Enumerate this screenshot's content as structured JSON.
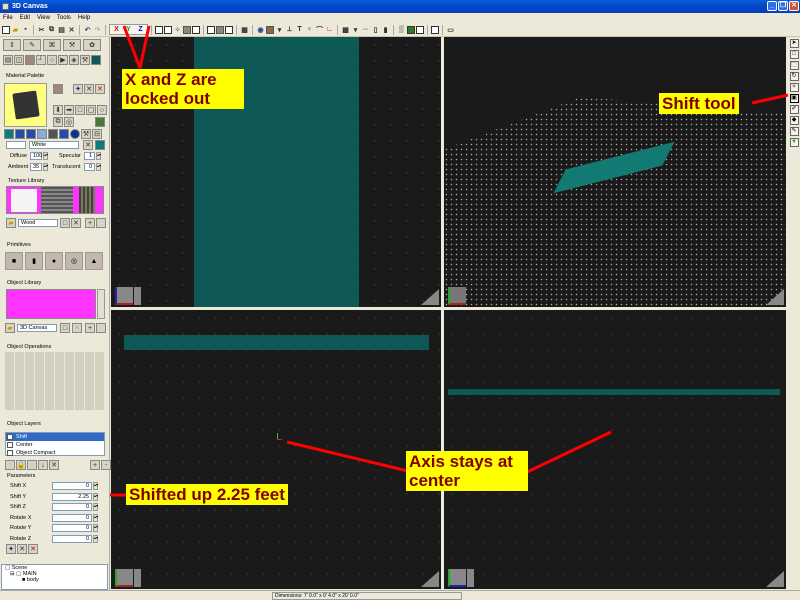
{
  "window": {
    "title": "3D Canvas",
    "controls": [
      "minimize",
      "restore",
      "close"
    ]
  },
  "menu": [
    "File",
    "Edit",
    "View",
    "Tools",
    "Help"
  ],
  "toolbar": {
    "axis_lock": {
      "x": "X",
      "y": "Y",
      "z": "Z"
    },
    "buttons": [
      "new-icon",
      "open-icon",
      "save-icon",
      "cut-icon",
      "copy-icon",
      "paste-icon",
      "delete-icon",
      "undo-icon",
      "redo-icon"
    ]
  },
  "left_panel": {
    "material_palette": {
      "title": "Material Palette",
      "material_name": "White",
      "diffuse_label": "Diffuse",
      "diffuse_value": "100",
      "specular_label": "Specular",
      "specular_value": "1",
      "ambient_label": "Ambient",
      "ambient_value": "35",
      "translucent_label": "Translucent",
      "translucent_value": "0"
    },
    "texture_library": {
      "title": "Texture Library",
      "selected": "Wood"
    },
    "primitives": {
      "title": "Primitives",
      "items": [
        "cube",
        "cylinder",
        "sphere",
        "torus",
        "cone"
      ]
    },
    "object_library": {
      "title": "Object Library",
      "selected": "3D Canvas"
    },
    "object_operations": {
      "title": "Object Operations"
    },
    "object_layers": {
      "title": "Object Layers",
      "items": [
        {
          "name": "Shift",
          "selected": true
        },
        {
          "name": "Center",
          "selected": false
        },
        {
          "name": "Object Compact",
          "selected": false
        }
      ]
    },
    "parameters": {
      "title": "Parameters",
      "items": [
        {
          "label": "Shift X",
          "value": "0"
        },
        {
          "label": "Shift Y",
          "value": "2.25"
        },
        {
          "label": "Shift Z",
          "value": "0"
        },
        {
          "label": "Rotate X",
          "value": "0"
        },
        {
          "label": "Rotate Y",
          "value": "0"
        },
        {
          "label": "Rotate Z",
          "value": "0"
        }
      ]
    },
    "scene_tree": [
      {
        "label": "Scene",
        "level": 0
      },
      {
        "label": "MAIN",
        "level": 1
      },
      {
        "label": "body",
        "level": 2
      }
    ]
  },
  "status_bar": {
    "dimensions": "Dimensions: 7' 0.0\" x 0' 4.0\" x 20' 0.0\""
  },
  "callouts": {
    "axis_lock": "X and Z are locked out",
    "shift_tool": "Shift tool",
    "shifted": "Shifted up 2.25 feet",
    "axis_center": "Axis stays at center"
  },
  "colors": {
    "object": "#0e5955",
    "viewport_bg": "#1a1a1a",
    "callout_bg": "#ffff00",
    "callout_text": "#800000",
    "arrow": "#ff0000"
  }
}
